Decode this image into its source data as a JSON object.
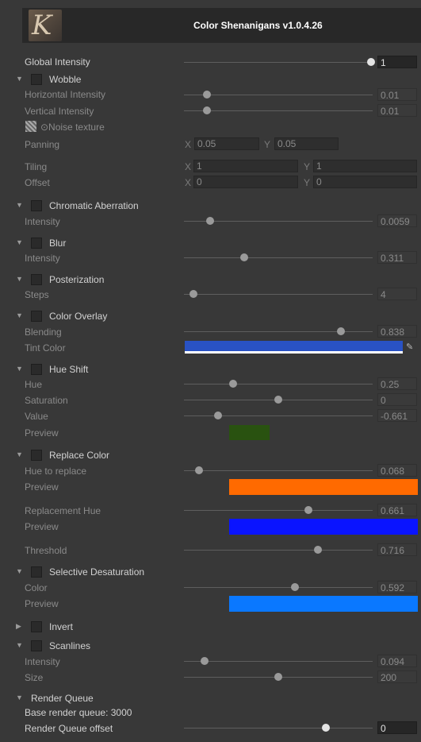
{
  "header": {
    "title": "Color Shenanigans v1.0.4.26",
    "logo_letter": "K"
  },
  "global_intensity": {
    "label": "Global Intensity",
    "value": "1",
    "fraction": 1.0
  },
  "wobble": {
    "title": "Wobble",
    "horizontal": {
      "label": "Horizontal Intensity",
      "value": "0.01",
      "fraction": 0.12
    },
    "vertical": {
      "label": "Vertical Intensity",
      "value": "0.01",
      "fraction": 0.12
    },
    "noise_label": "⊙Noise texture",
    "panning": {
      "label": "Panning",
      "x_label": "X",
      "x": "0.05",
      "y_label": "Y",
      "y": "0.05"
    },
    "tiling": {
      "label": "Tiling",
      "x_label": "X",
      "x": "1",
      "y_label": "Y",
      "y": "1"
    },
    "offset": {
      "label": "Offset",
      "x_label": "X",
      "x": "0",
      "y_label": "Y",
      "y": "0"
    }
  },
  "chromatic": {
    "title": "Chromatic Aberration",
    "intensity": {
      "label": "Intensity",
      "value": "0.0059",
      "fraction": 0.14
    }
  },
  "blur": {
    "title": "Blur",
    "intensity": {
      "label": "Intensity",
      "value": "0.311",
      "fraction": 0.32
    }
  },
  "posterization": {
    "title": "Posterization",
    "steps": {
      "label": "Steps",
      "value": "4",
      "fraction": 0.05
    }
  },
  "color_overlay": {
    "title": "Color Overlay",
    "blending": {
      "label": "Blending",
      "value": "0.838",
      "fraction": 0.83
    },
    "tint": {
      "label": "Tint Color",
      "color": "#2952c4"
    }
  },
  "hue_shift": {
    "title": "Hue Shift",
    "hue": {
      "label": "Hue",
      "value": "0.25",
      "fraction": 0.26
    },
    "saturation": {
      "label": "Saturation",
      "value": "0",
      "fraction": 0.5
    },
    "value": {
      "label": "Value",
      "value": "-0.661",
      "fraction": 0.18
    },
    "preview": {
      "label": "Preview",
      "color": "#295210"
    }
  },
  "replace_color": {
    "title": "Replace Color",
    "hue_to_replace": {
      "label": "Hue to replace",
      "value": "0.068",
      "fraction": 0.08
    },
    "preview1": {
      "label": "Preview",
      "color": "#ff6a00"
    },
    "replacement_hue": {
      "label": "Replacement Hue",
      "value": "0.661",
      "fraction": 0.66
    },
    "preview2": {
      "label": "Preview",
      "color": "#0a14ff"
    },
    "threshold": {
      "label": "Threshold",
      "value": "0.716",
      "fraction": 0.71
    }
  },
  "selective": {
    "title": "Selective Desaturation",
    "color": {
      "label": "Color",
      "value": "0.592",
      "fraction": 0.59
    },
    "preview": {
      "label": "Preview",
      "color": "#0a78ff"
    }
  },
  "invert": {
    "title": "Invert"
  },
  "scanlines": {
    "title": "Scanlines",
    "intensity": {
      "label": "Intensity",
      "value": "0.094",
      "fraction": 0.11
    },
    "size": {
      "label": "Size",
      "value": "200",
      "fraction": 0.5
    }
  },
  "render_queue": {
    "title": "Render Queue",
    "base": "Base render queue: 3000",
    "offset": {
      "label": "Render Queue offset",
      "value": "0",
      "fraction": 0.75
    }
  }
}
